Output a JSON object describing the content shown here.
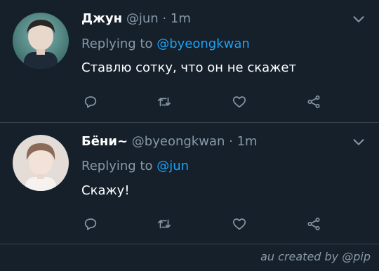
{
  "colors": {
    "background": "#15202b",
    "divider": "#38444d",
    "secondary_text": "#8899a6",
    "mention": "#1da1f2"
  },
  "tweets": [
    {
      "name": "Джун",
      "handle": "@jun",
      "separator": "·",
      "time": "1m",
      "replying_label": "Replying to",
      "replying_to": "@byeongkwan",
      "text": "Ставлю сотку, что он не скажет",
      "icons": [
        "reply-icon",
        "retweet-icon",
        "like-icon",
        "share-icon"
      ]
    },
    {
      "name": "Бёни~",
      "handle": "@byeongkwan",
      "separator": "·",
      "time": "1m",
      "replying_label": "Replying to",
      "replying_to": "@jun",
      "text": "Скажу!",
      "icons": [
        "reply-icon",
        "retweet-icon",
        "like-icon",
        "share-icon"
      ]
    }
  ],
  "footer": "au created by @pip"
}
